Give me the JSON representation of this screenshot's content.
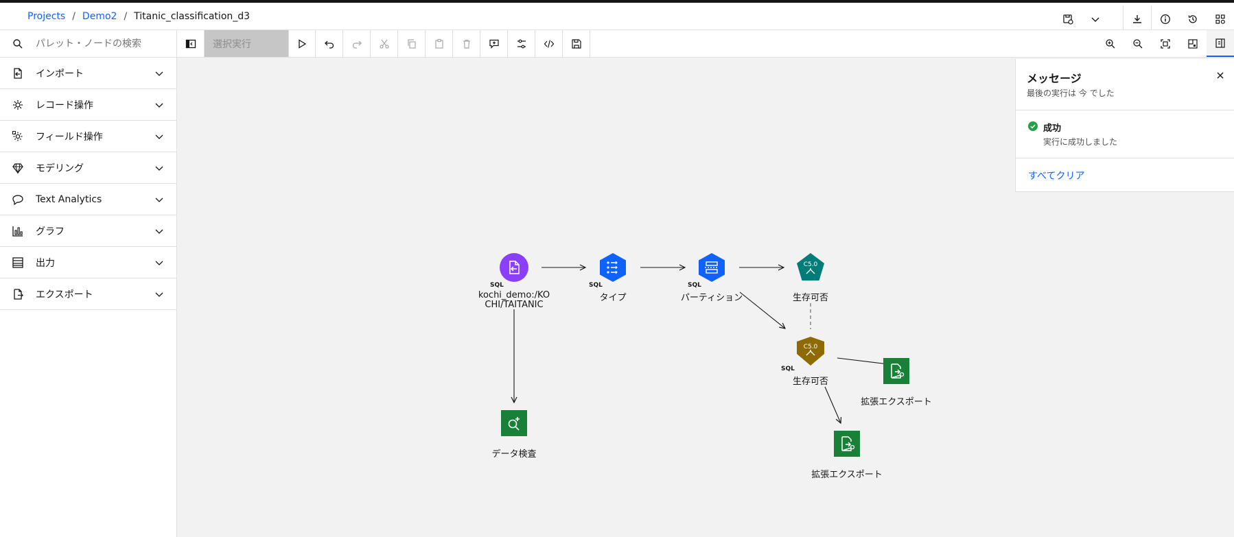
{
  "breadcrumb": {
    "projects": "Projects",
    "sep1": "/",
    "project": "Demo2",
    "sep2": "/",
    "flow": "Titanic_classification_d3"
  },
  "search": {
    "placeholder": "パレット・ノードの検索"
  },
  "toolbar": {
    "run_selection": "選択実行"
  },
  "palette": {
    "items": [
      {
        "label": "インポート",
        "icon": "import-icon"
      },
      {
        "label": "レコード操作",
        "icon": "record-ops-icon"
      },
      {
        "label": "フィールド操作",
        "icon": "field-ops-icon"
      },
      {
        "label": "モデリング",
        "icon": "modeling-icon"
      },
      {
        "label": "Text Analytics",
        "icon": "text-analytics-icon"
      },
      {
        "label": "グラフ",
        "icon": "graph-icon"
      },
      {
        "label": "出力",
        "icon": "output-icon"
      },
      {
        "label": "エクスポート",
        "icon": "export-icon"
      }
    ]
  },
  "nodes": {
    "source": {
      "label1": "kochi_demo:/KO",
      "label2": "CHI/TAITANIC",
      "sql": "SQL",
      "color": "#8a3ffc"
    },
    "type": {
      "label": "タイプ",
      "sql": "SQL",
      "color": "#0f62fe"
    },
    "partition": {
      "label": "パーティション",
      "sql": "SQL",
      "color": "#0f62fe"
    },
    "c50_model": {
      "label": "生存可否",
      "badge": "C5.0",
      "color": "#007d79"
    },
    "c50_nugget": {
      "label": "生存可否",
      "badge": "C5.0",
      "sql": "SQL",
      "color": "#8e6a00"
    },
    "data_audit": {
      "label": "データ検査",
      "color": "#198038"
    },
    "export1": {
      "label": "拡張エクスポート",
      "color": "#198038"
    },
    "export2": {
      "label": "拡張エクスポート",
      "color": "#198038"
    }
  },
  "messages": {
    "title": "メッセージ",
    "subtitle": "最後の実行は 今 でした",
    "status_title": "成功",
    "status_text": "実行に成功しました",
    "clear_all": "すべてクリア",
    "success_color": "#24a148"
  }
}
